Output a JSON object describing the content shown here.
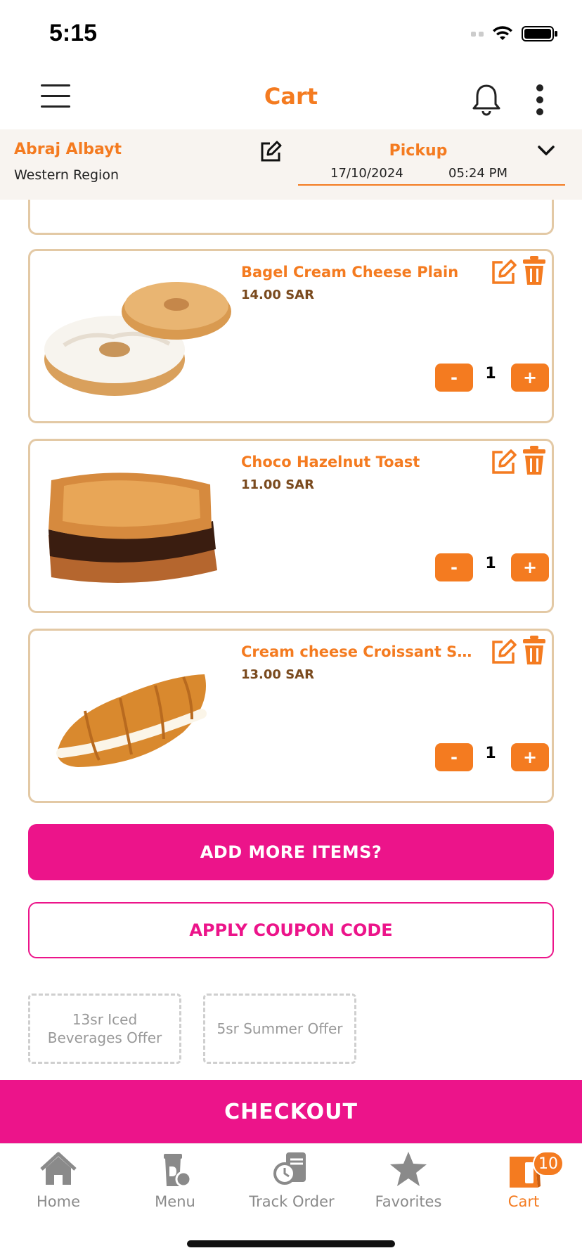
{
  "status_bar": {
    "time": "5:15"
  },
  "header": {
    "title": "Cart"
  },
  "store": {
    "name": "Abraj Albayt",
    "region": "Western Region",
    "mode": "Pickup",
    "date": "17/10/2024",
    "time": "05:24 PM"
  },
  "cart_items": [
    {
      "name": "Bagel Cream Cheese Plain",
      "price": "14.00 SAR",
      "qty": "1"
    },
    {
      "name": "Choco Hazelnut Toast",
      "price": "11.00 SAR",
      "qty": "1"
    },
    {
      "name": "Cream cheese Croissant Sandwich",
      "price": "13.00 SAR",
      "qty": "1"
    }
  ],
  "qty_controls": {
    "minus": "-",
    "plus": "+"
  },
  "actions": {
    "add_more": "ADD MORE ITEMS?",
    "coupon": "APPLY COUPON CODE",
    "checkout": "CHECKOUT"
  },
  "offers": [
    "13sr Iced Beverages Offer",
    "5sr Summer Offer"
  ],
  "tabbar": {
    "items": [
      {
        "label": "Home",
        "icon": "home-icon"
      },
      {
        "label": "Menu",
        "icon": "menu-cup-icon"
      },
      {
        "label": "Track Order",
        "icon": "track-order-icon"
      },
      {
        "label": "Favorites",
        "icon": "star-icon"
      },
      {
        "label": "Cart",
        "icon": "cart-bag-icon",
        "badge": "10"
      }
    ],
    "active": "Cart"
  },
  "colors": {
    "accent": "#f47b20",
    "pink": "#ec148a",
    "card_border": "#e3c9a5"
  }
}
